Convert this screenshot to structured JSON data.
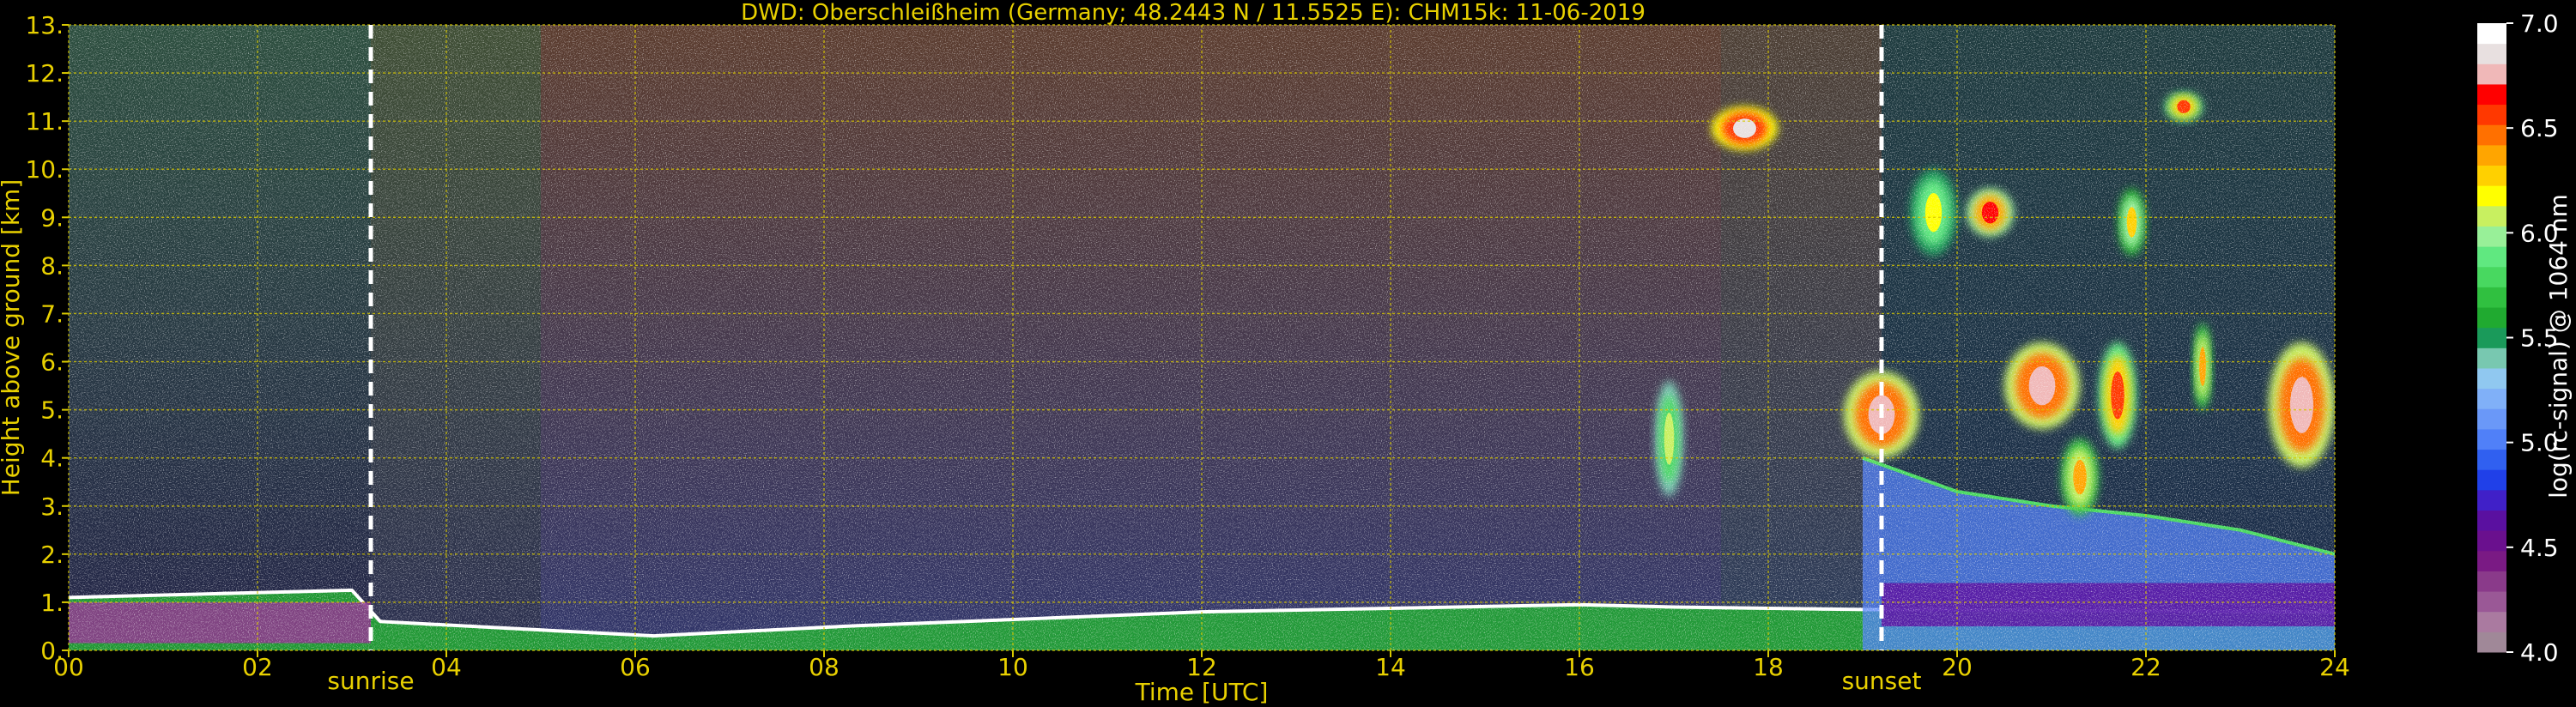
{
  "chart_data": {
    "type": "heatmap",
    "title": "DWD: Oberschleißheim (Germany; 48.2443 N / 11.5525 E):    CHM15k: 11-06-2019",
    "xlabel": "Time [UTC]",
    "ylabel": "Height above ground [km]",
    "xlim": [
      0,
      24
    ],
    "ylim": [
      0,
      13
    ],
    "x_ticks": [
      0,
      2,
      4,
      6,
      8,
      10,
      12,
      14,
      16,
      18,
      20,
      22,
      24
    ],
    "x_tick_labels": [
      "00",
      "02",
      "04",
      "06",
      "08",
      "10",
      "12",
      "14",
      "16",
      "18",
      "20",
      "22",
      "24"
    ],
    "y_ticks": [
      0,
      1,
      2,
      3,
      4,
      5,
      6,
      7,
      8,
      9,
      10,
      11,
      12,
      13
    ],
    "y_tick_labels": [
      "0.",
      "1.",
      "2.",
      "3.",
      "4.",
      "5.",
      "6.",
      "7.",
      "8.",
      "9.",
      "10.",
      "11.",
      "12.",
      "13."
    ],
    "grid": true,
    "colorbar": {
      "label": "log(rc-signal) @ 1064 nm",
      "range": [
        4.0,
        7.0
      ],
      "ticks": [
        4.0,
        4.5,
        5.0,
        5.5,
        6.0,
        6.5,
        7.0
      ],
      "tick_labels": [
        "4.0",
        "4.5",
        "5.0",
        "5.5",
        "6.0",
        "6.5",
        "7.0"
      ],
      "colors": [
        "#a08898",
        "#aa7aa0",
        "#9a5896",
        "#8a3a8a",
        "#7a1a84",
        "#6a108e",
        "#5a10a0",
        "#4020c8",
        "#2040e8",
        "#3060f0",
        "#5080f8",
        "#6a98f8",
        "#80b0f8",
        "#90c8f0",
        "#78c8b0",
        "#1a9a5a",
        "#20aa30",
        "#30c040",
        "#48d860",
        "#60e880",
        "#98f098",
        "#c8f060",
        "#ffff00",
        "#ffd000",
        "#ffa500",
        "#ff7000",
        "#ff3800",
        "#ff0000",
        "#f0b8b8",
        "#e8e0e0",
        "#ffffff"
      ]
    },
    "events": [
      {
        "label": "sunrise",
        "x": 3.2
      },
      {
        "label": "sunset",
        "x": 19.2
      }
    ],
    "features": [
      {
        "name": "boundary layer top",
        "x": [
          0.0,
          3.0,
          3.3,
          6.2,
          8.2,
          12.0,
          16.0,
          17.0,
          19.0,
          24.0
        ],
        "y": [
          1.1,
          1.25,
          0.6,
          0.3,
          0.5,
          0.8,
          0.95,
          0.9,
          0.85,
          0.8
        ]
      },
      {
        "name": "night aerosol layer top",
        "x": [
          19.0,
          20.0,
          21.0,
          22.0,
          23.0,
          24.0
        ],
        "y": [
          4.0,
          3.3,
          3.0,
          2.8,
          2.5,
          2.0
        ]
      }
    ],
    "clouds": [
      {
        "x": [
          18.8,
          19.6
        ],
        "y": [
          4.0,
          5.8
        ],
        "level": 6.8
      },
      {
        "x": [
          20.1,
          20.6
        ],
        "y": [
          8.6,
          9.6
        ],
        "level": 6.7
      },
      {
        "x": [
          19.5,
          20.0
        ],
        "y": [
          8.2,
          10.0
        ],
        "level": 6.2
      },
      {
        "x": [
          20.5,
          21.3
        ],
        "y": [
          4.6,
          6.4
        ],
        "level": 6.8
      },
      {
        "x": [
          21.5,
          21.9
        ],
        "y": [
          4.2,
          6.4
        ],
        "level": 6.6
      },
      {
        "x": [
          21.1,
          21.5
        ],
        "y": [
          2.8,
          4.4
        ],
        "level": 6.4
      },
      {
        "x": [
          21.7,
          22.0
        ],
        "y": [
          8.2,
          9.6
        ],
        "level": 6.3
      },
      {
        "x": [
          22.2,
          22.6
        ],
        "y": [
          11.0,
          11.6
        ],
        "level": 6.6
      },
      {
        "x": [
          22.5,
          22.7
        ],
        "y": [
          5.0,
          6.8
        ],
        "level": 6.4
      },
      {
        "x": [
          23.3,
          24.0
        ],
        "y": [
          3.8,
          6.4
        ],
        "level": 6.8
      },
      {
        "x": [
          17.4,
          18.1
        ],
        "y": [
          10.4,
          11.3
        ],
        "level": 6.9
      },
      {
        "x": [
          16.8,
          17.1
        ],
        "y": [
          3.2,
          5.6
        ],
        "level": 6.1
      }
    ]
  }
}
